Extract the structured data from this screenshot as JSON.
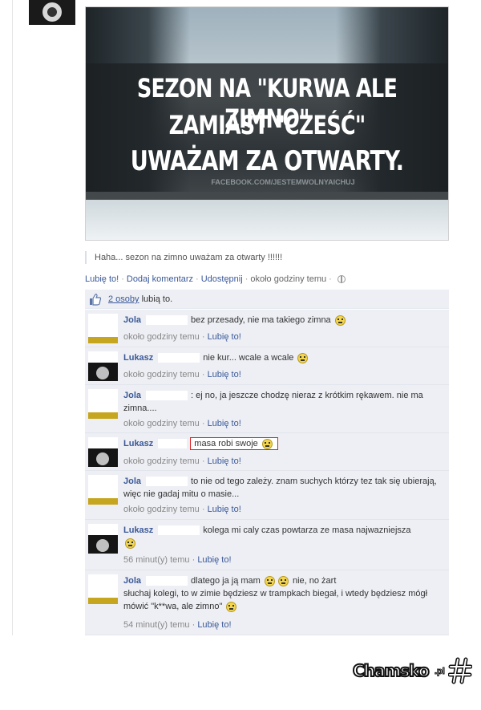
{
  "post": {
    "image_lines": [
      "SEZON NA \"KURWA ALE ZIMNO\"",
      "ZAMIAST \"CZEŚĆ\"",
      "UWAŻAM ZA OTWARTY."
    ],
    "image_watermark": "FACEBOOK.COM/JESTEMWOLNYAICHUJ",
    "caption": "Haha... sezon na zimno uważam za otwarty !!!!!!"
  },
  "actions": {
    "like": "Lubię to!",
    "comment": "Dodaj komentarz",
    "share": "Udostępnij",
    "time": "około godziny temu"
  },
  "likes": {
    "count": "2 osoby",
    "suffix": "lubią to."
  },
  "comments": [
    {
      "name": "Jola",
      "text": "bez przesady, nie ma takiego zimna",
      "time": "około godziny temu",
      "like": "Lubię to!"
    },
    {
      "name": "Lukasz",
      "text": "nie kur... wcale a wcale",
      "time": "około godziny temu",
      "like": "Lubię to!"
    },
    {
      "name": "Jola",
      "text": ": ej no, ja jeszcze chodzę nieraz z krótkim rękawem. nie ma zimna....",
      "time": "około godziny temu",
      "like": "Lubię to!"
    },
    {
      "name": "Lukasz",
      "text": "masa robi swoje",
      "time": "około godziny temu",
      "like": "Lubię to!"
    },
    {
      "name": "Jola",
      "text": "to nie od tego zależy. znam suchych którzy tez tak się ubierają, więc nie gadaj mitu o masie...",
      "time": "około godziny temu",
      "like": "Lubię to!"
    },
    {
      "name": "Lukasz",
      "text": "kolega mi caly czas powtarza ze masa najwazniejsza",
      "time": "56 minut(y) temu",
      "like": "Lubię to!"
    },
    {
      "name": "Jola",
      "text_a": "dlatego ja ją mam",
      "text_b": "nie, no żart",
      "text_c": "słuchaj kolegi, to w zimie będziesz w trampkach biegał, i wtedy będziesz mógł mówić \"k**wa, ale zimno\"",
      "time": "54 minut(y) temu",
      "like": "Lubię to!"
    }
  ],
  "logo": {
    "text": "Chamsko",
    "tld": ".pl"
  }
}
